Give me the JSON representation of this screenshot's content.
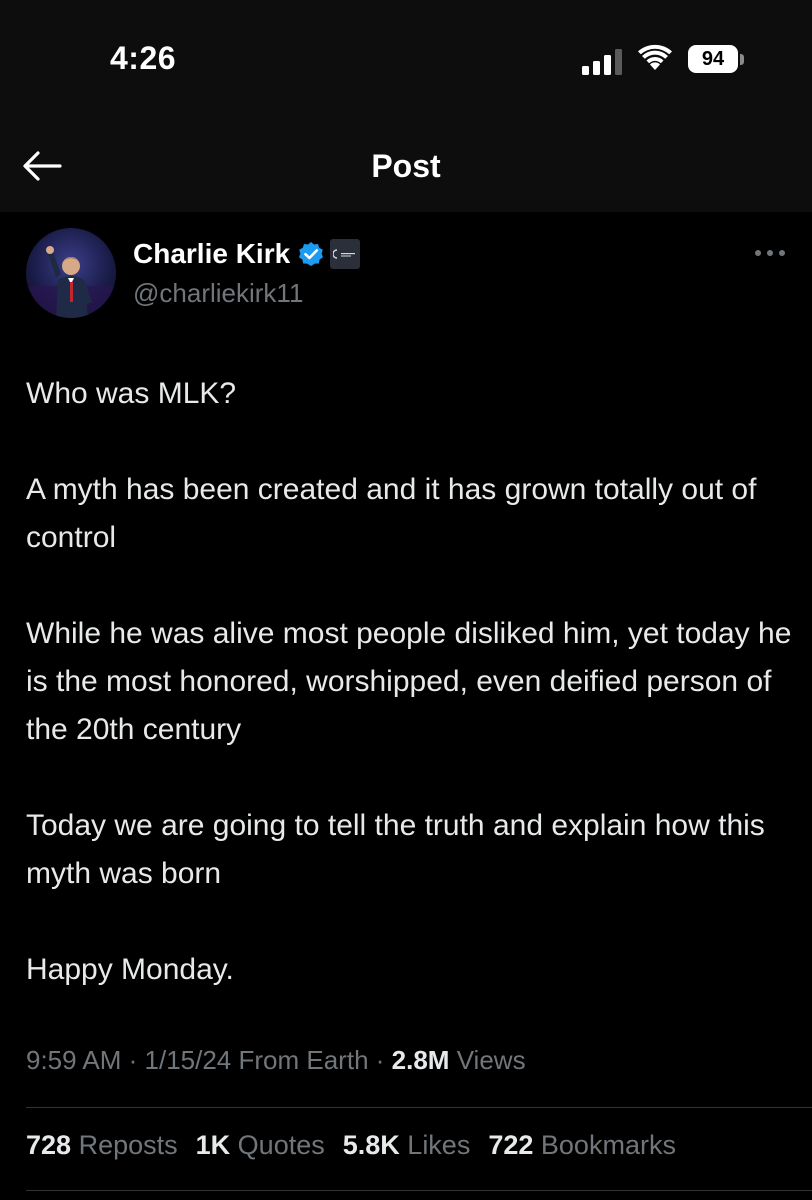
{
  "status_bar": {
    "time": "4:26",
    "battery_level": "94"
  },
  "header": {
    "title": "Post"
  },
  "author": {
    "name": "Charlie Kirk",
    "handle": "@charliekirk11",
    "verified": true
  },
  "post": {
    "paragraphs": [
      "Who was MLK?",
      "A myth has been created and it has grown totally out of control",
      "While he was alive most people disliked him, yet today he is the most honored, worshipped, even deified person of the 20th century",
      "Today we are going to tell the truth and explain how this myth was born",
      "Happy Monday."
    ]
  },
  "meta": {
    "time": "9:59 AM",
    "separator": " · ",
    "date": "1/15/24",
    "source": "From Earth",
    "views_count": "2.8M",
    "views_label": "Views"
  },
  "stats": {
    "reposts_count": "728",
    "reposts_label": "Reposts",
    "quotes_count": "1K",
    "quotes_label": "Quotes",
    "likes_count": "5.8K",
    "likes_label": "Likes",
    "bookmarks_count": "722",
    "bookmarks_label": "Bookmarks"
  },
  "colors": {
    "background": "#000000",
    "header_background": "#0d0d0d",
    "primary_text": "#e7e9ea",
    "secondary_text": "#71767b",
    "verified_blue": "#1d9bf0",
    "divider": "#2f3336"
  },
  "icons": {
    "back": "arrow-left-icon",
    "verified": "verified-badge-icon",
    "affiliate": "affiliate-badge-icon",
    "more": "more-horizontal-icon",
    "signal": "cellular-signal-icon",
    "wifi": "wifi-icon",
    "battery": "battery-icon"
  }
}
